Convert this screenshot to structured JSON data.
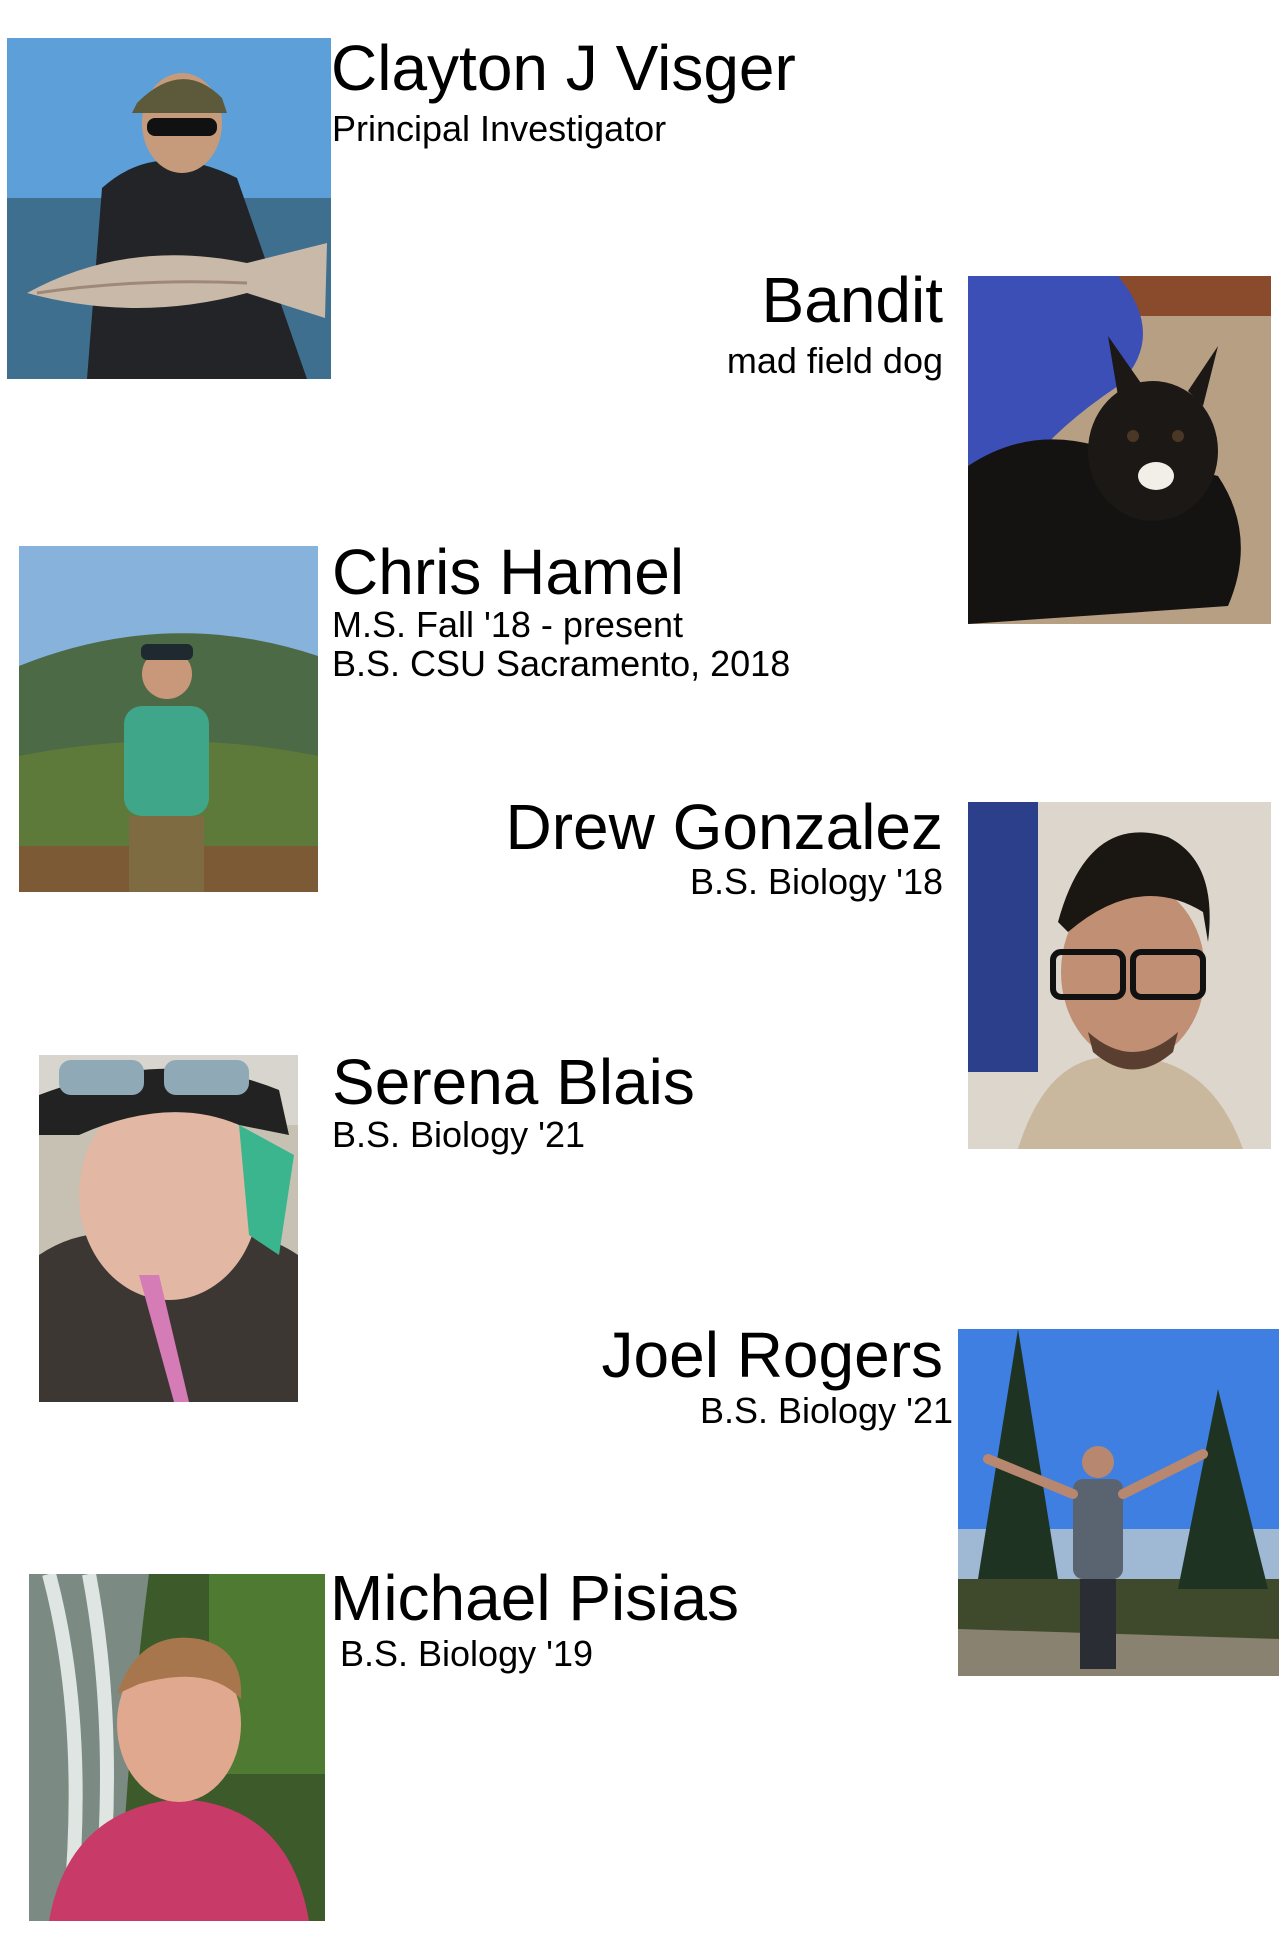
{
  "members": [
    {
      "name": "Clayton J Visger",
      "role": [
        "Principal Investigator"
      ],
      "photo_icon": "person-with-fish-photo"
    },
    {
      "name": "Bandit",
      "role": [
        "mad field dog"
      ],
      "photo_icon": "dog-photo"
    },
    {
      "name": "Chris Hamel",
      "role": [
        "M.S. Fall '18 - present",
        "B.S. CSU Sacramento, 2018"
      ],
      "photo_icon": "person-hiking-photo"
    },
    {
      "name": "Drew Gonzalez",
      "role": [
        "B.S. Biology '18"
      ],
      "photo_icon": "person-portrait-photo"
    },
    {
      "name": "Serena Blais",
      "role": [
        "B.S. Biology '21"
      ],
      "photo_icon": "person-selfie-photo"
    },
    {
      "name": "Joel Rogers",
      "role": [
        "B.S. Biology '21"
      ],
      "photo_icon": "person-mountain-photo"
    },
    {
      "name": "Michael Pisias",
      "role": [
        "B.S. Biology '19"
      ],
      "photo_icon": "person-waterfall-photo"
    }
  ]
}
